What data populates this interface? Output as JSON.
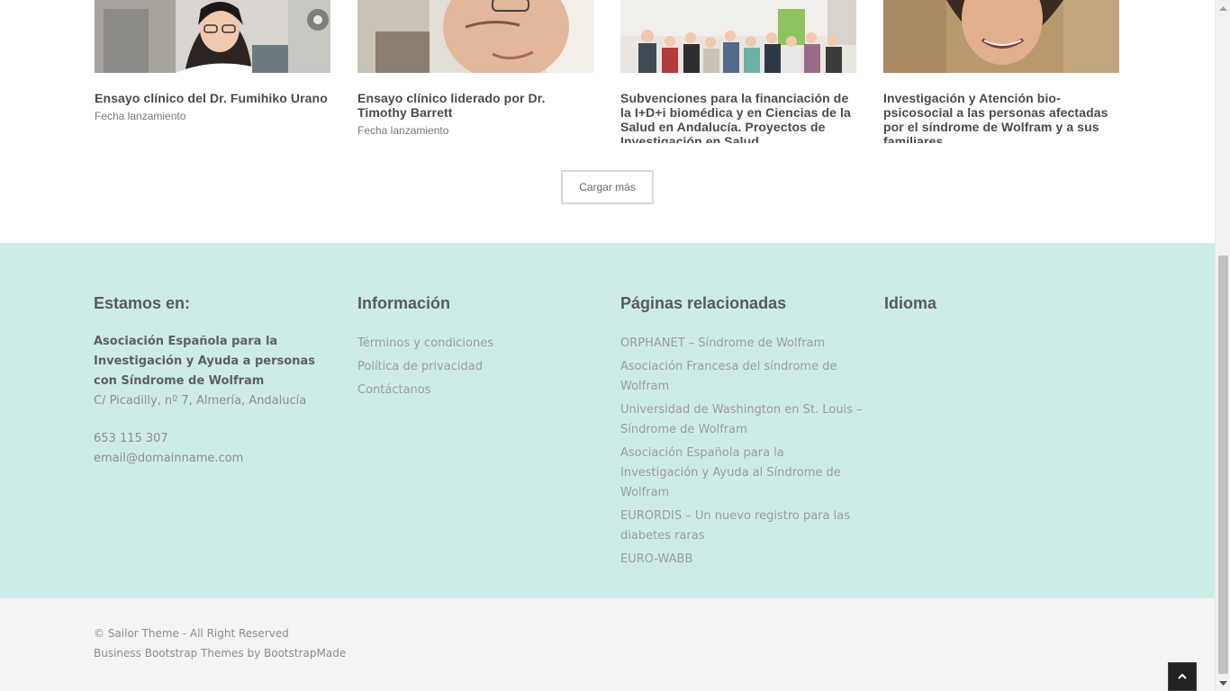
{
  "cards": [
    {
      "title": "Ensayo clínico del Dr. Fumihiko Urano",
      "date": "Fecha lanzamiento"
    },
    {
      "title": "Ensayo clínico liderado por Dr. Timothy Barrett",
      "date": "Fecha lanzamiento"
    },
    {
      "title": "Subvenciones para la financiación de la I+D+i biomédica y en Ciencias de la Salud en Andalucía. Proyectos de Investigación en Salud",
      "date": ""
    },
    {
      "title": "Investigación y Atención bio-psicosocial a las personas afectadas por el síndrome de Wolfram y a sus familiares",
      "date": ""
    }
  ],
  "load_more": "Cargar más",
  "footer": {
    "col1": {
      "heading": "Estamos en:",
      "org": "Asociación Española para la Investigación y Ayuda a personas con Síndrome de Wolfram",
      "address": "C/ Picadilly, nº 7, Almería, Andalucía",
      "phone": "653 115 307",
      "email": "email@domainname.com"
    },
    "col2": {
      "heading": "Información",
      "links": [
        "Términos y condiciones",
        "Política de privacidad",
        "Contáctanos"
      ]
    },
    "col3": {
      "heading": "Páginas relacionadas",
      "links": [
        "ORPHANET – Síndrome de Wolfram",
        "Asociación Francesa del síndrome de Wolfram",
        "Universidad de Washington en St. Louis – Síndrome de Wolfram",
        "Asociación Española para la Investigación y Ayuda al Síndrome de Wolfram",
        "EURORDIS – Un nuevo registro para las diabetes raras",
        "EURO-WABB"
      ]
    },
    "col4": {
      "heading": "Idioma"
    }
  },
  "bottom": {
    "copyright": "© Sailor Theme - All Right Reserved",
    "credit": "Business Bootstrap Themes by BootstrapMade"
  },
  "icons": {
    "to_top": "chevron-up-icon"
  }
}
